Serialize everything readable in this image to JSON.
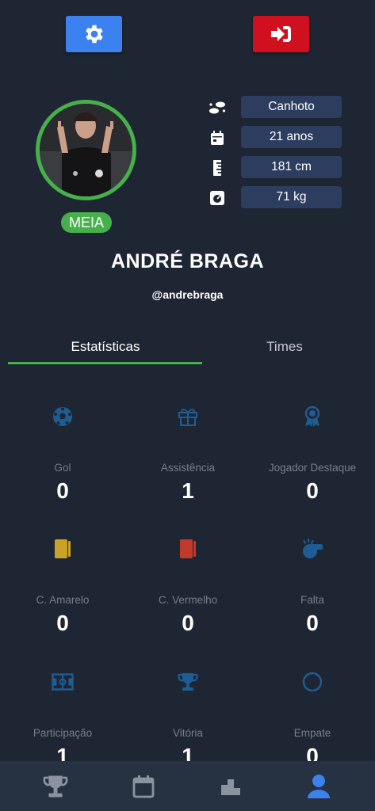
{
  "header": {
    "settings_icon": "gear-icon",
    "logout_icon": "sign-out-icon",
    "colors": {
      "settings": "#3b82f0",
      "logout": "#d0101f"
    }
  },
  "profile": {
    "position": "MEIA",
    "name": "ANDRÉ BRAGA",
    "handle": "@andrebraga",
    "info": [
      {
        "icon": "footsteps-icon",
        "value": "Canhoto"
      },
      {
        "icon": "calendar-icon",
        "value": "21 anos"
      },
      {
        "icon": "ruler-icon",
        "value": "181 cm"
      },
      {
        "icon": "weight-scale-icon",
        "value": "71 kg"
      }
    ],
    "accent_color": "#46b04b"
  },
  "tabs": [
    {
      "label": "Estatísticas",
      "active": true
    },
    {
      "label": "Times",
      "active": false
    }
  ],
  "stats": [
    {
      "icon": "soccer-ball-icon",
      "label": "Gol",
      "value": "0"
    },
    {
      "icon": "gift-icon",
      "label": "Assistência",
      "value": "1"
    },
    {
      "icon": "award-icon",
      "label": "Jogador Destaque",
      "value": "0"
    },
    {
      "icon": "yellow-card-icon",
      "label": "C. Amarelo",
      "value": "0"
    },
    {
      "icon": "red-card-icon",
      "label": "C. Vermelho",
      "value": "0"
    },
    {
      "icon": "whistle-icon",
      "label": "Falta",
      "value": "0"
    },
    {
      "icon": "soccer-field-icon",
      "label": "Participação",
      "value": "1"
    },
    {
      "icon": "trophy-icon",
      "label": "Vitória",
      "value": "1"
    },
    {
      "icon": "circle-icon",
      "label": "Empate",
      "value": "0"
    }
  ],
  "bottom_nav": [
    {
      "icon": "trophy-icon",
      "active": false
    },
    {
      "icon": "calendar-icon",
      "active": false
    },
    {
      "icon": "podium-icon",
      "active": false
    },
    {
      "icon": "user-icon",
      "active": true
    }
  ]
}
